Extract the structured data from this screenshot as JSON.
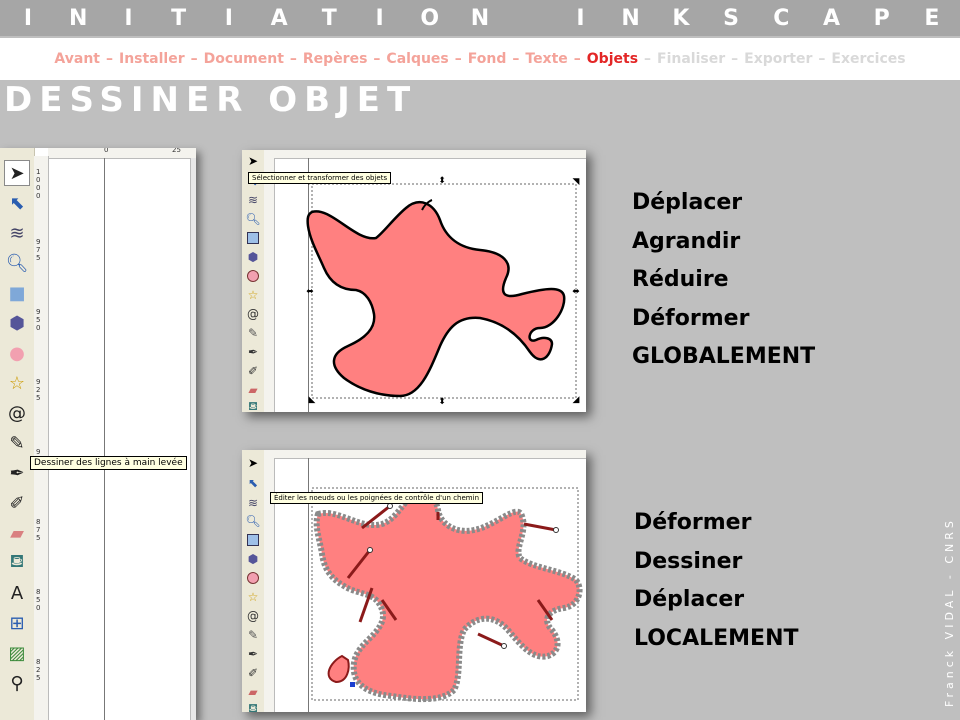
{
  "banner": {
    "letters": [
      "I",
      "N",
      "I",
      "T",
      "I",
      "A",
      "T",
      "I",
      "O",
      "N",
      " ",
      "I",
      "N",
      "K",
      "S",
      "C",
      "A",
      "P",
      "E"
    ]
  },
  "nav": {
    "items": [
      {
        "label": "Avant",
        "state": "done"
      },
      {
        "label": "Installer",
        "state": "done"
      },
      {
        "label": "Document",
        "state": "done"
      },
      {
        "label": "Repères",
        "state": "done"
      },
      {
        "label": "Calques",
        "state": "done"
      },
      {
        "label": "Fond",
        "state": "done"
      },
      {
        "label": "Texte",
        "state": "done"
      },
      {
        "label": "Objets",
        "state": "active"
      },
      {
        "label": "Finaliser",
        "state": "future"
      },
      {
        "label": "Exporter",
        "state": "future"
      },
      {
        "label": "Exercices",
        "state": "future"
      }
    ],
    "separator": "–"
  },
  "page": {
    "title": "DESSINER OBJET"
  },
  "left_panel": {
    "ruler_top": [
      "0",
      "25"
    ],
    "ruler_left": [
      "1 0 0 0",
      "9 7 5",
      "9 5 0",
      "9 2 5",
      "9",
      "8 7 5",
      "8 5 0",
      "8 2 5"
    ],
    "tools": [
      "selector-icon",
      "node-editor-icon",
      "tweak-icon",
      "zoom-icon",
      "rectangle-icon",
      "3d-box-icon",
      "ellipse-icon",
      "star-icon",
      "spiral-icon",
      "pencil-icon",
      "pen-icon",
      "calligraphy-icon",
      "eraser-icon",
      "paint-bucket-icon",
      "text-icon",
      "connector-icon",
      "gradient-icon",
      "dropper-icon"
    ],
    "tooltip": "Dessiner des lignes à main levée"
  },
  "shot_global": {
    "tooltip": "Sélectionner et transformer des objets"
  },
  "shot_local": {
    "tooltip": "Éditer les noeuds ou les poignées de contrôle d'un chemin"
  },
  "actions_global": [
    "Déplacer",
    "Agrandir",
    "Réduire",
    "Déformer",
    "GLOBALEMENT"
  ],
  "actions_local": [
    "Déformer",
    "Dessiner",
    "Déplacer",
    "LOCALEMENT"
  ],
  "credit": "Franck VIDAL - CNRS",
  "colors": {
    "shape_fill": "#ff8080",
    "accent": "#e32626",
    "nav_done": "#f4a39a",
    "nav_future": "#d9d9d9"
  }
}
